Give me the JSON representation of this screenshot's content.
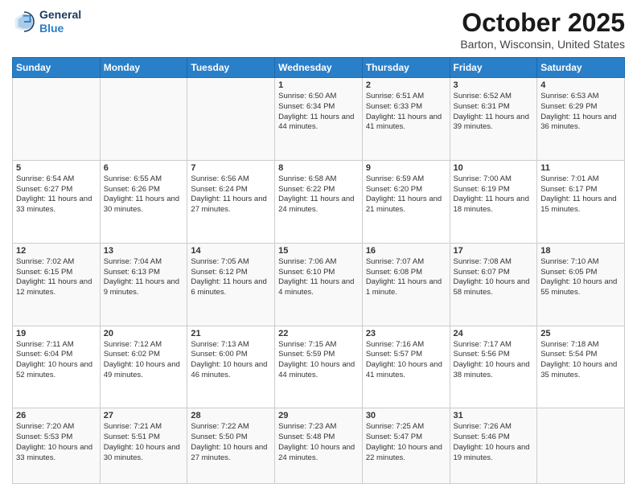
{
  "header": {
    "logo_line1": "General",
    "logo_line2": "Blue",
    "month": "October 2025",
    "location": "Barton, Wisconsin, United States"
  },
  "weekdays": [
    "Sunday",
    "Monday",
    "Tuesday",
    "Wednesday",
    "Thursday",
    "Friday",
    "Saturday"
  ],
  "weeks": [
    [
      {
        "day": "",
        "data": ""
      },
      {
        "day": "",
        "data": ""
      },
      {
        "day": "",
        "data": ""
      },
      {
        "day": "1",
        "data": "Sunrise: 6:50 AM\nSunset: 6:34 PM\nDaylight: 11 hours and 44 minutes."
      },
      {
        "day": "2",
        "data": "Sunrise: 6:51 AM\nSunset: 6:33 PM\nDaylight: 11 hours and 41 minutes."
      },
      {
        "day": "3",
        "data": "Sunrise: 6:52 AM\nSunset: 6:31 PM\nDaylight: 11 hours and 39 minutes."
      },
      {
        "day": "4",
        "data": "Sunrise: 6:53 AM\nSunset: 6:29 PM\nDaylight: 11 hours and 36 minutes."
      }
    ],
    [
      {
        "day": "5",
        "data": "Sunrise: 6:54 AM\nSunset: 6:27 PM\nDaylight: 11 hours and 33 minutes."
      },
      {
        "day": "6",
        "data": "Sunrise: 6:55 AM\nSunset: 6:26 PM\nDaylight: 11 hours and 30 minutes."
      },
      {
        "day": "7",
        "data": "Sunrise: 6:56 AM\nSunset: 6:24 PM\nDaylight: 11 hours and 27 minutes."
      },
      {
        "day": "8",
        "data": "Sunrise: 6:58 AM\nSunset: 6:22 PM\nDaylight: 11 hours and 24 minutes."
      },
      {
        "day": "9",
        "data": "Sunrise: 6:59 AM\nSunset: 6:20 PM\nDaylight: 11 hours and 21 minutes."
      },
      {
        "day": "10",
        "data": "Sunrise: 7:00 AM\nSunset: 6:19 PM\nDaylight: 11 hours and 18 minutes."
      },
      {
        "day": "11",
        "data": "Sunrise: 7:01 AM\nSunset: 6:17 PM\nDaylight: 11 hours and 15 minutes."
      }
    ],
    [
      {
        "day": "12",
        "data": "Sunrise: 7:02 AM\nSunset: 6:15 PM\nDaylight: 11 hours and 12 minutes."
      },
      {
        "day": "13",
        "data": "Sunrise: 7:04 AM\nSunset: 6:13 PM\nDaylight: 11 hours and 9 minutes."
      },
      {
        "day": "14",
        "data": "Sunrise: 7:05 AM\nSunset: 6:12 PM\nDaylight: 11 hours and 6 minutes."
      },
      {
        "day": "15",
        "data": "Sunrise: 7:06 AM\nSunset: 6:10 PM\nDaylight: 11 hours and 4 minutes."
      },
      {
        "day": "16",
        "data": "Sunrise: 7:07 AM\nSunset: 6:08 PM\nDaylight: 11 hours and 1 minute."
      },
      {
        "day": "17",
        "data": "Sunrise: 7:08 AM\nSunset: 6:07 PM\nDaylight: 10 hours and 58 minutes."
      },
      {
        "day": "18",
        "data": "Sunrise: 7:10 AM\nSunset: 6:05 PM\nDaylight: 10 hours and 55 minutes."
      }
    ],
    [
      {
        "day": "19",
        "data": "Sunrise: 7:11 AM\nSunset: 6:04 PM\nDaylight: 10 hours and 52 minutes."
      },
      {
        "day": "20",
        "data": "Sunrise: 7:12 AM\nSunset: 6:02 PM\nDaylight: 10 hours and 49 minutes."
      },
      {
        "day": "21",
        "data": "Sunrise: 7:13 AM\nSunset: 6:00 PM\nDaylight: 10 hours and 46 minutes."
      },
      {
        "day": "22",
        "data": "Sunrise: 7:15 AM\nSunset: 5:59 PM\nDaylight: 10 hours and 44 minutes."
      },
      {
        "day": "23",
        "data": "Sunrise: 7:16 AM\nSunset: 5:57 PM\nDaylight: 10 hours and 41 minutes."
      },
      {
        "day": "24",
        "data": "Sunrise: 7:17 AM\nSunset: 5:56 PM\nDaylight: 10 hours and 38 minutes."
      },
      {
        "day": "25",
        "data": "Sunrise: 7:18 AM\nSunset: 5:54 PM\nDaylight: 10 hours and 35 minutes."
      }
    ],
    [
      {
        "day": "26",
        "data": "Sunrise: 7:20 AM\nSunset: 5:53 PM\nDaylight: 10 hours and 33 minutes."
      },
      {
        "day": "27",
        "data": "Sunrise: 7:21 AM\nSunset: 5:51 PM\nDaylight: 10 hours and 30 minutes."
      },
      {
        "day": "28",
        "data": "Sunrise: 7:22 AM\nSunset: 5:50 PM\nDaylight: 10 hours and 27 minutes."
      },
      {
        "day": "29",
        "data": "Sunrise: 7:23 AM\nSunset: 5:48 PM\nDaylight: 10 hours and 24 minutes."
      },
      {
        "day": "30",
        "data": "Sunrise: 7:25 AM\nSunset: 5:47 PM\nDaylight: 10 hours and 22 minutes."
      },
      {
        "day": "31",
        "data": "Sunrise: 7:26 AM\nSunset: 5:46 PM\nDaylight: 10 hours and 19 minutes."
      },
      {
        "day": "",
        "data": ""
      }
    ]
  ]
}
